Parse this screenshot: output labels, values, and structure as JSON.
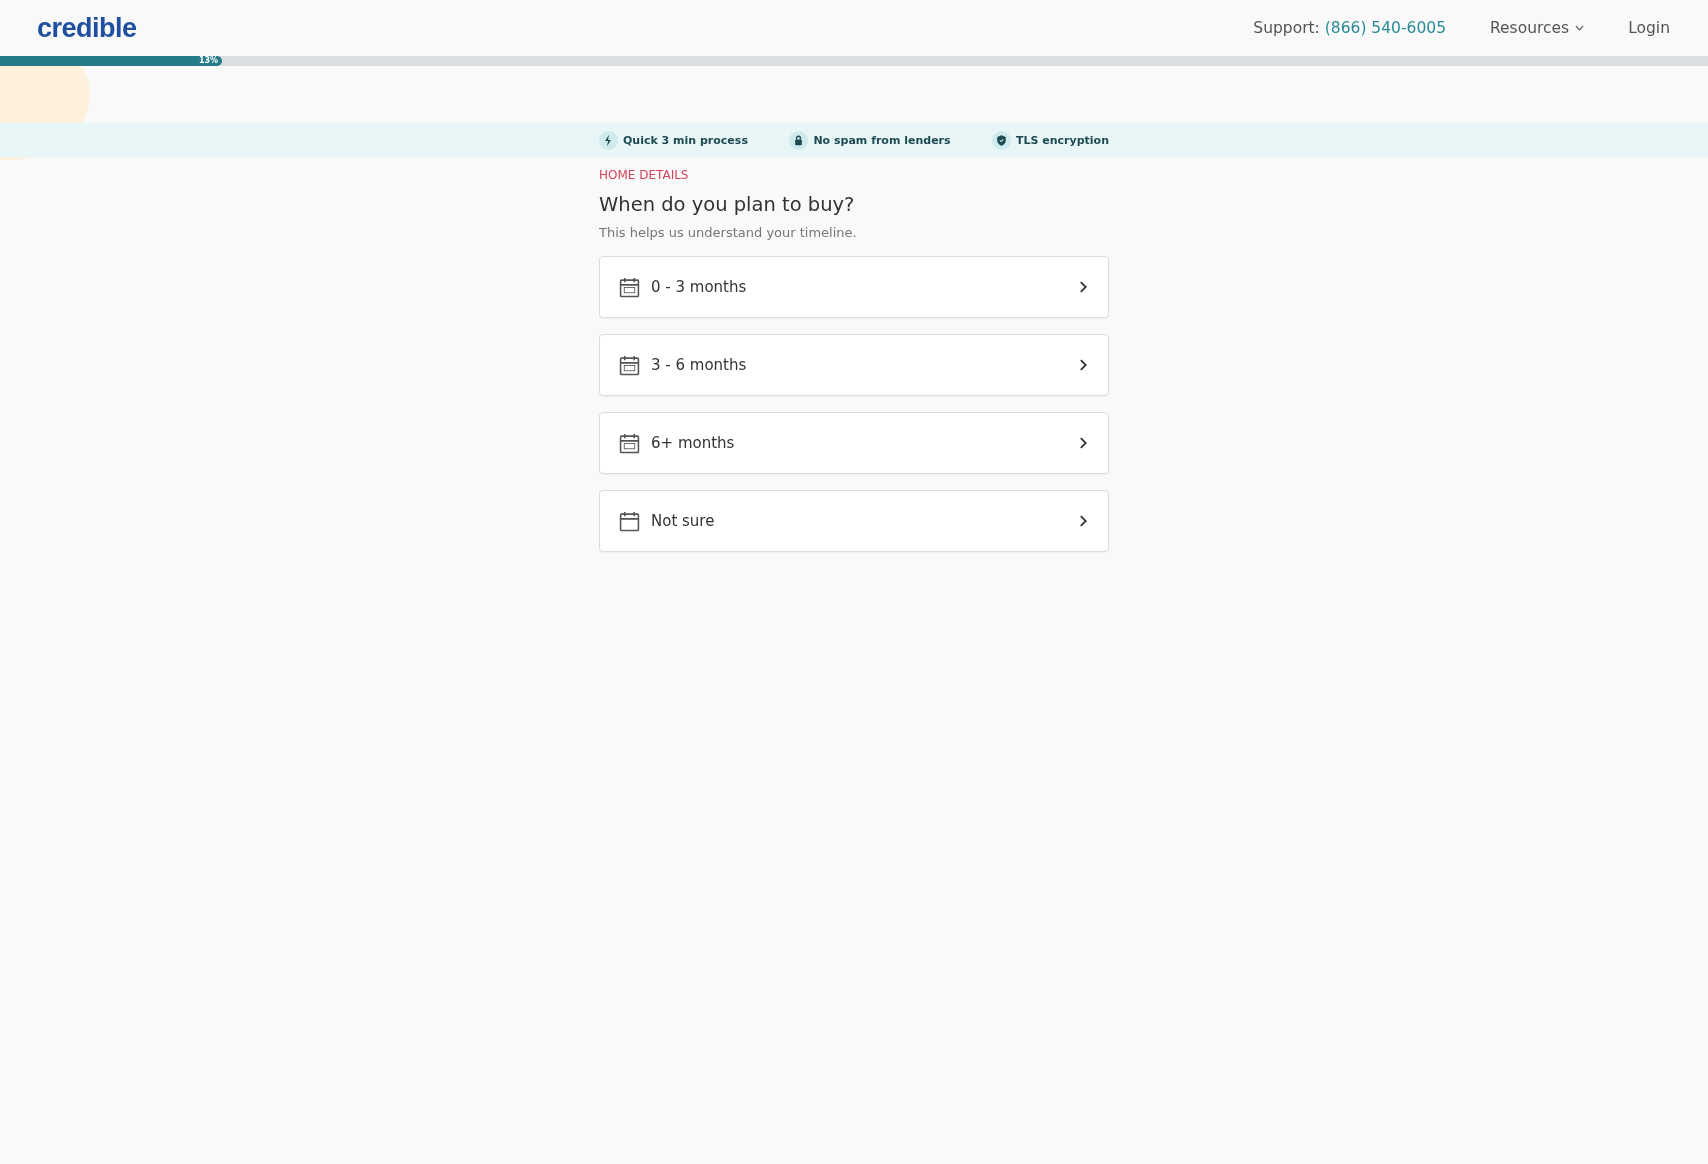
{
  "header": {
    "logo": "credible",
    "support_label": "Support:",
    "support_phone": "(866) 540-6005",
    "resources": "Resources",
    "login": "Login"
  },
  "progress": {
    "level": 0.13,
    "label": "13%"
  },
  "trust_items": [
    {
      "kind": "bolt",
      "text": "Quick 3 min process"
    },
    {
      "kind": "lock",
      "text": "No spam from lenders"
    },
    {
      "kind": "shield",
      "text": "TLS encryption"
    }
  ],
  "section_label": "HOME DETAILS",
  "question": "When do you plan to buy?",
  "hint": "This helps us understand your timeline.",
  "options": [
    {
      "kind": "dated",
      "label": "0 - 3 months"
    },
    {
      "kind": "dated",
      "label": "3 - 6 months"
    },
    {
      "kind": "dated",
      "label": "6+ months"
    },
    {
      "kind": "blank",
      "label": "Not sure"
    }
  ]
}
